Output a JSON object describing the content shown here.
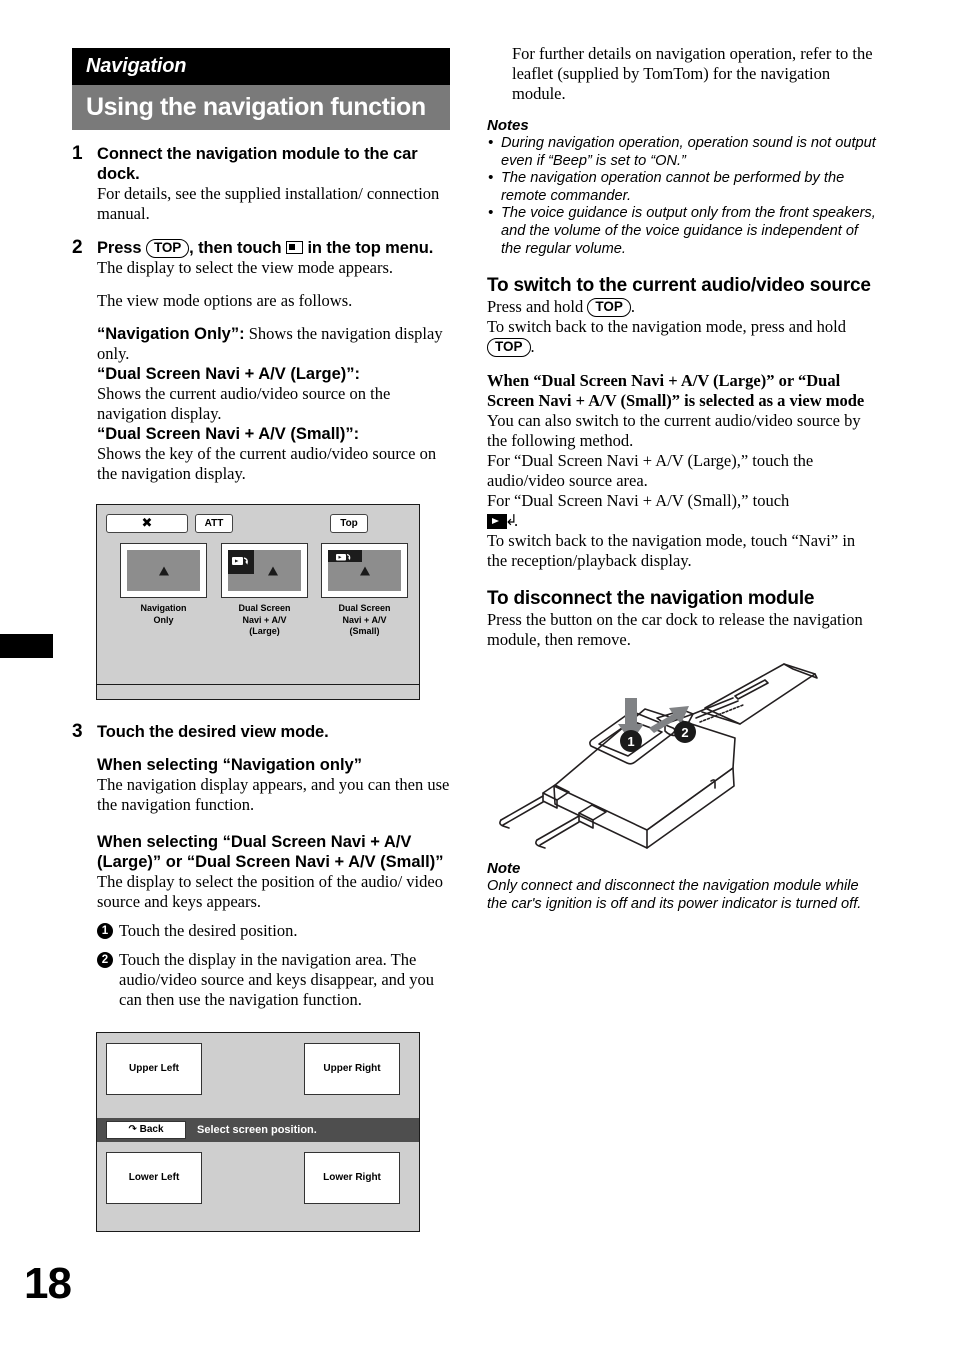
{
  "page": {
    "number": "18",
    "section_label": "Navigation",
    "section_title": "Using the navigation function"
  },
  "left_column": {
    "steps": [
      {
        "num": "1",
        "heading": "Connect the navigation module to the car dock.",
        "body": "For details, see the supplied installation/ connection manual."
      },
      {
        "num": "2",
        "heading_part1": "Press",
        "key": "TOP",
        "heading_part2": ", then touch",
        "heading_part3": "in the top menu.",
        "body": "The display to select the view mode appears.",
        "body2": "The view mode options are as follows."
      },
      {
        "num": "3",
        "heading": "Touch the desired view mode."
      }
    ],
    "view_modes": [
      {
        "term": "“Navigation Only”:",
        "desc": " Shows the navigation display only."
      },
      {
        "term": "“Dual Screen Navi + A/V (Large)”:",
        "desc": "Shows the current audio/video source on the navigation display."
      },
      {
        "term": "“Dual Screen Navi + A/V (Small)”:",
        "desc": "Shows the key of the current audio/video source on the navigation display."
      }
    ],
    "step3": {
      "sub1_heading": "When selecting “Navigation only”",
      "sub1_body": "The navigation display appears, and you can then use the navigation function.",
      "sub2_heading": "When selecting “Dual Screen Navi + A/V (Large)” or “Dual Screen Navi + A/V (Small)”",
      "sub2_body": "The display to select the position of the audio/ video source and keys appears.",
      "items": [
        {
          "n": "1",
          "text": "Touch the desired position."
        },
        {
          "n": "2",
          "text": "Touch the display in the navigation area. The audio/video source and keys disappear, and you can then use the navigation function."
        }
      ]
    },
    "diagram_view_mode": {
      "buttons": {
        "close": "✖",
        "att": "ATT",
        "top": "Top"
      },
      "options": [
        {
          "label": "Navigation\nOnly",
          "label_line1": "Navigation",
          "label_line2": "Only",
          "label_line3": ""
        },
        {
          "label_line1": "Dual Screen",
          "label_line2": "Navi + A/V",
          "label_line3": "(Large)"
        },
        {
          "label_line1": "Dual Screen",
          "label_line2": "Navi + A/V",
          "label_line3": "(Small)"
        }
      ]
    },
    "diagram_position": {
      "cells": [
        "Upper Left",
        "Upper Right",
        "Lower Left",
        "Lower Right"
      ],
      "back_label": "Back",
      "bar_label": "Select screen position."
    }
  },
  "right_column": {
    "intro": "For further details on navigation operation, refer to the leaflet (supplied by TomTom) for the navigation module.",
    "notes_heading": "Notes",
    "notes": [
      "During navigation operation, operation sound is not output even if “Beep” is set to “ON.”",
      "The navigation operation cannot be performed by the remote commander.",
      "The voice guidance is output only from the front speakers, and the volume of the voice guidance is independent of the regular volume."
    ],
    "switch_section": {
      "heading": "To switch to the current audio/video source",
      "line1_a": "Press and hold",
      "line1_key": "TOP",
      "line1_b": ".",
      "line2_a": "To switch back to the navigation mode, press and hold",
      "line2_key": "TOP",
      "line2_b": ".",
      "sub_heading": "When “Dual Screen Navi + A/V (Large)” or “Dual Screen Navi + A/V (Small)” is selected as a view mode",
      "body1": "You can also switch to the current audio/video source by the following method.",
      "body2": "For “Dual Screen Navi + A/V (Large),” touch the audio/video source area.",
      "body3_a": "For “Dual Screen Navi + A/V (Small),” touch",
      "body3_b": ".",
      "body4": "To switch back to the navigation mode, touch “Navi” in the reception/playback display."
    },
    "disconnect_section": {
      "heading": "To disconnect the navigation module",
      "body": "Press the button on the car dock to release the navigation module, then remove.",
      "callouts": [
        "1",
        "2"
      ]
    },
    "note": {
      "heading": "Note",
      "body": "Only connect and disconnect the navigation module while the car's ignition is off and its power indicator is turned off."
    }
  },
  "colors": {
    "banner_black": "#000000",
    "banner_gray": "#7a7a7a",
    "screen_bg": "#cfcfcf",
    "screen_inner": "#8d8d8d",
    "bar_dark": "#4e4e4e"
  }
}
